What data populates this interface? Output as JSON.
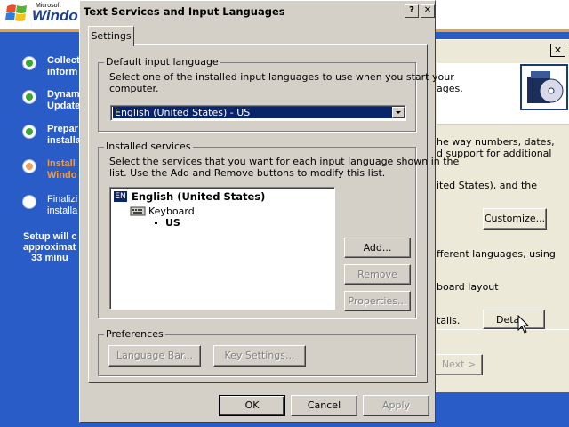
{
  "setup": {
    "logo_small": "Microsoft",
    "logo_word": "Windo",
    "steps": [
      {
        "label": "Collect\ninform",
        "state": "done"
      },
      {
        "label": "Dynam\nUpdate",
        "state": "done"
      },
      {
        "label": "Prepar\ninstalla",
        "state": "done"
      },
      {
        "label": "Install\nWindo",
        "state": "current"
      },
      {
        "label": "Finalizi\ninstalla",
        "state": "pending"
      }
    ],
    "note": "Setup will c\napproximat\n   33 minu"
  },
  "regional": {
    "close_glyph": "✕",
    "text_1": "ages.",
    "text_2": "he way numbers, dates,\nd support for additional",
    "text_3": "ited States), and the",
    "customize_label": "Customize...",
    "text_4": "fferent languages, using",
    "text_5": "board layout",
    "text_6": "tails.",
    "details_label": "Deta",
    "next_label": "Next >"
  },
  "dialog": {
    "title": "Text Services and Input Languages",
    "help_glyph": "?",
    "close_glyph": "✕",
    "tab_settings": "Settings",
    "default_group": {
      "legend": "Default input language",
      "description": "Select one of the installed input languages to use when you start your\ncomputer.",
      "selected_value": "English (United States) - US"
    },
    "installed_group": {
      "legend": "Installed services",
      "description": "Select the services that you want for each input language shown in the\nlist. Use the Add and Remove buttons to modify this list.",
      "tree": {
        "badge": "EN",
        "language": "English (United States)",
        "category": "Keyboard",
        "layout": "US"
      },
      "add_label": "Add...",
      "remove_label": "Remove",
      "properties_label": "Properties..."
    },
    "preferences_group": {
      "legend": "Preferences",
      "language_bar_label": "Language Bar...",
      "key_settings_label": "Key Settings..."
    },
    "ok_label": "OK",
    "cancel_label": "Cancel",
    "apply_label": "Apply"
  }
}
